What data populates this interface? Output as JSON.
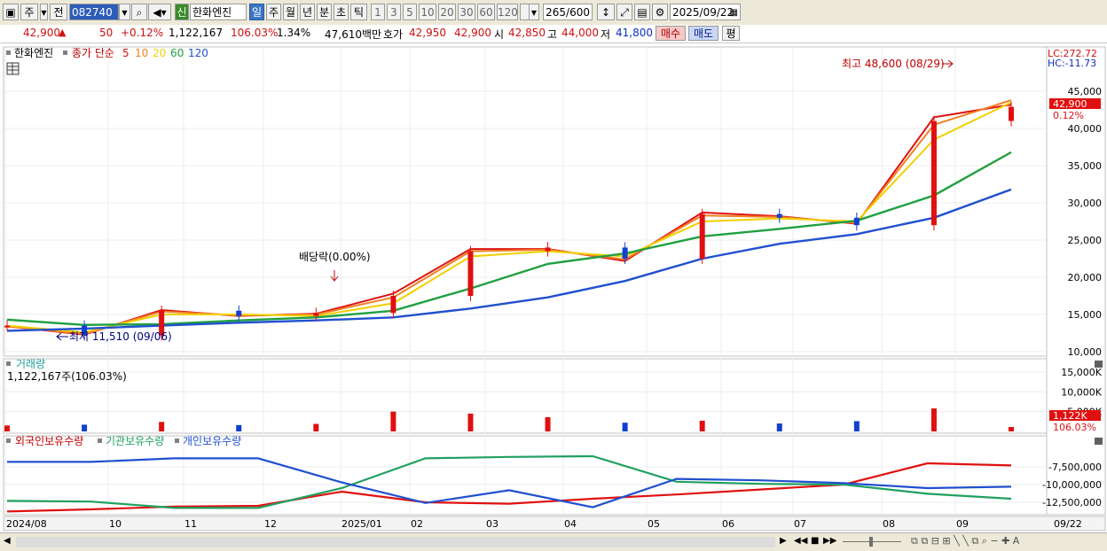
{
  "toolbar": {
    "period_toggle": "주",
    "prev_label": "전",
    "code": "082740",
    "credit_badge": "신",
    "stock_name": "한화엔진",
    "periods": [
      "일",
      "주",
      "월",
      "년",
      "분",
      "초",
      "틱"
    ],
    "active_period": "일",
    "intervals": [
      "1",
      "3",
      "5",
      "10",
      "20",
      "30",
      "60",
      "120"
    ],
    "count_value": "265",
    "count_total": "/600",
    "date": "2025/09/22"
  },
  "quote": {
    "price": "42,900",
    "arrow": "▲",
    "change": "50",
    "change_pct": "+0.12%",
    "volume": "1,122,167",
    "volume_ratio": "106.03%",
    "turnover": "1.34%",
    "amount": "47,610백만",
    "bid_label": "호가",
    "bid1": "42,950",
    "bid2": "42,900",
    "open_label": "시",
    "open": "42,850",
    "high_label": "고",
    "high": "44,000",
    "low_label": "저",
    "low": "41,800",
    "buy_label": "매수",
    "sell_label": "매도",
    "eval_label": "평"
  },
  "legend": {
    "name": "한화엔진",
    "ma_prefix": "종가 단순",
    "ma": [
      {
        "label": "5",
        "color": "#e01010"
      },
      {
        "label": "10",
        "color": "#f08020"
      },
      {
        "label": "20",
        "color": "#f0d000"
      },
      {
        "label": "60",
        "color": "#20a040"
      },
      {
        "label": "120",
        "color": "#2050d0"
      }
    ]
  },
  "right_info": {
    "lc": "LC:272.72",
    "hc": "HC:-11.73",
    "price_tag": "42,900",
    "pct_tag": "0.12%",
    "vol_tag": "1,122K",
    "vol_pct_tag": "106.03%"
  },
  "annotations": {
    "max": "최고 48,600 (08/29)",
    "min": "최저 11,510 (09/06)",
    "dividend": "배당락(0.00%)"
  },
  "volume_panel": {
    "title": "거래량",
    "value": "1,122,167주(106.03%)"
  },
  "holdings_panel": {
    "series_labels": [
      "외국인보유수량",
      "기관보유수량",
      "개인보유수량"
    ]
  },
  "x_axis_labels": [
    "2024/08",
    "10",
    "11",
    "12",
    "2025/01",
    "02",
    "03",
    "04",
    "05",
    "06",
    "07",
    "08",
    "09",
    "09/22"
  ],
  "chart_data": [
    {
      "type": "candlestick",
      "title": "한화엔진",
      "ylim": [
        10000,
        50000
      ],
      "y_ticks": [
        "10,000",
        "15,000",
        "20,000",
        "25,000",
        "30,000",
        "35,000",
        "40,000",
        "45,000"
      ],
      "categories": [
        "2024/08",
        "2024/09",
        "2024/10",
        "2024/11",
        "2024/12",
        "2025/01",
        "2025/02",
        "2025/03",
        "2025/04",
        "2025/05",
        "2025/06",
        "2025/07",
        "2025/08",
        "2025/09"
      ],
      "series": [
        {
          "name": "종가",
          "values": [
            13500,
            12200,
            15500,
            14800,
            15200,
            17500,
            23500,
            24000,
            22500,
            28500,
            28000,
            27000,
            41000,
            42900
          ]
        },
        {
          "name": "5",
          "values": [
            13400,
            12300,
            15600,
            14800,
            15100,
            17800,
            23800,
            23800,
            22200,
            28700,
            28200,
            27200,
            41500,
            43200
          ]
        },
        {
          "name": "10",
          "values": [
            13400,
            12400,
            15400,
            14900,
            15000,
            17300,
            23500,
            23700,
            22400,
            28300,
            28100,
            27300,
            40500,
            43800
          ]
        },
        {
          "name": "20",
          "values": [
            13500,
            12600,
            15000,
            15000,
            14800,
            16500,
            22800,
            23500,
            22800,
            27500,
            27900,
            27500,
            38500,
            43500
          ]
        },
        {
          "name": "60",
          "values": [
            14300,
            13600,
            13700,
            14200,
            14600,
            15500,
            18500,
            21800,
            23200,
            25500,
            26500,
            27600,
            31000,
            36800
          ]
        },
        {
          "name": "120",
          "values": [
            12800,
            13100,
            13500,
            13900,
            14200,
            14600,
            15800,
            17300,
            19500,
            22500,
            24500,
            25800,
            28000,
            31800
          ]
        }
      ],
      "y_range_note": "",
      "max_point": {
        "value": 48600,
        "date": "08/29"
      },
      "min_point": {
        "value": 11510,
        "date": "09/06"
      }
    },
    {
      "type": "bar",
      "title": "거래량",
      "ylim": [
        0,
        17000
      ],
      "y_ticks": [
        "5,000K",
        "10,000K",
        "15,000K"
      ],
      "categories": [
        "2024/08",
        "2024/09",
        "2024/10",
        "2024/11",
        "2024/12",
        "2025/01",
        "2025/02",
        "2025/03",
        "2025/04",
        "2025/05",
        "2025/06",
        "2025/07",
        "2025/08",
        "2025/09"
      ],
      "values": [
        1500,
        1700,
        2400,
        1600,
        1900,
        5000,
        4500,
        3600,
        2200,
        2700,
        2000,
        2600,
        5800,
        1122
      ]
    },
    {
      "type": "line",
      "title": "보유수량",
      "ylim": [
        -14000000,
        -5000000
      ],
      "y_ticks": [
        "-7,500,000",
        "-10,000,000",
        "-12,500,000"
      ],
      "categories": [
        "2024/08",
        "2024/10",
        "2024/11",
        "2024/12",
        "2025/01",
        "2025/02",
        "2025/03",
        "2025/04",
        "2025/05",
        "2025/06",
        "2025/07",
        "2025/08",
        "2025/09"
      ],
      "series": [
        {
          "name": "외국인보유수량",
          "values": [
            -13800000,
            -13500000,
            -13100000,
            -13000000,
            -11000000,
            -12500000,
            -12700000,
            -12000000,
            -11400000,
            -10700000,
            -10000000,
            -7000000,
            -7300000
          ]
        },
        {
          "name": "기관보유수량",
          "values": [
            -12300000,
            -12400000,
            -13300000,
            -13300000,
            -10500000,
            -6300000,
            -6100000,
            -6000000,
            -9600000,
            -9900000,
            -10000000,
            -11300000,
            -12000000
          ]
        },
        {
          "name": "개인보유수량",
          "values": [
            -6800000,
            -6800000,
            -6300000,
            -6300000,
            -9700000,
            -12600000,
            -10800000,
            -13200000,
            -9200000,
            -9400000,
            -9800000,
            -10500000,
            -10300000
          ]
        }
      ],
      "colors": [
        "#e01010",
        "#20a060",
        "#2050d0"
      ]
    }
  ]
}
